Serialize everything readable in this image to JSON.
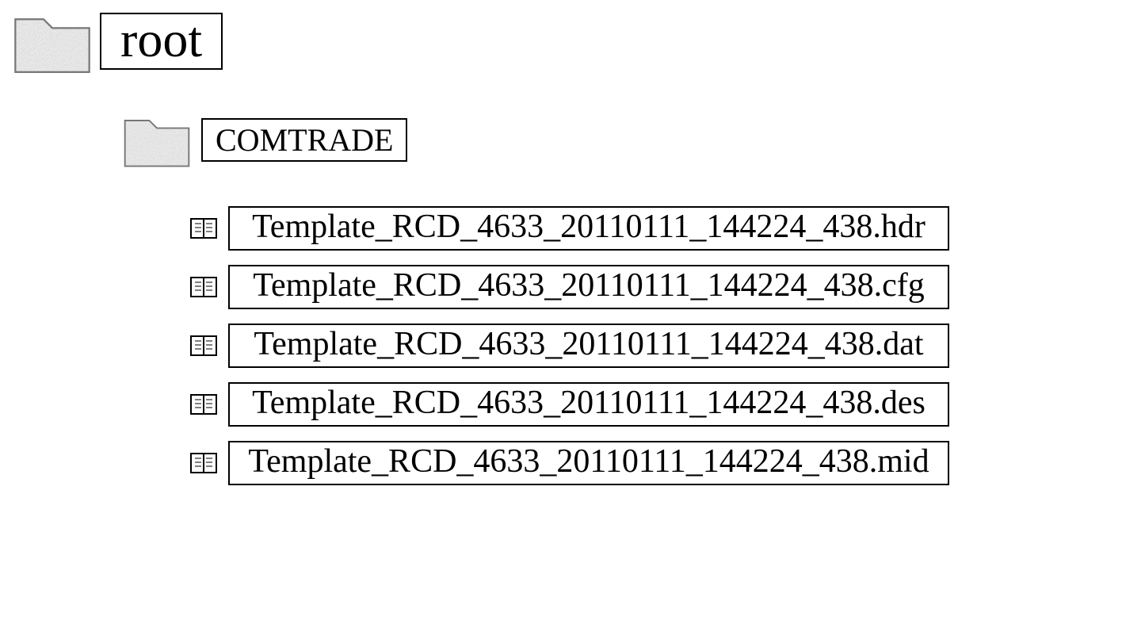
{
  "root": {
    "label": "root"
  },
  "subfolder": {
    "label": "COMTRADE"
  },
  "files": [
    {
      "name": "Template_RCD_4633_20110111_144224_438.hdr"
    },
    {
      "name": "Template_RCD_4633_20110111_144224_438.cfg"
    },
    {
      "name": "Template_RCD_4633_20110111_144224_438.dat"
    },
    {
      "name": "Template_RCD_4633_20110111_144224_438.des"
    },
    {
      "name": "Template_RCD_4633_20110111_144224_438.mid"
    }
  ]
}
